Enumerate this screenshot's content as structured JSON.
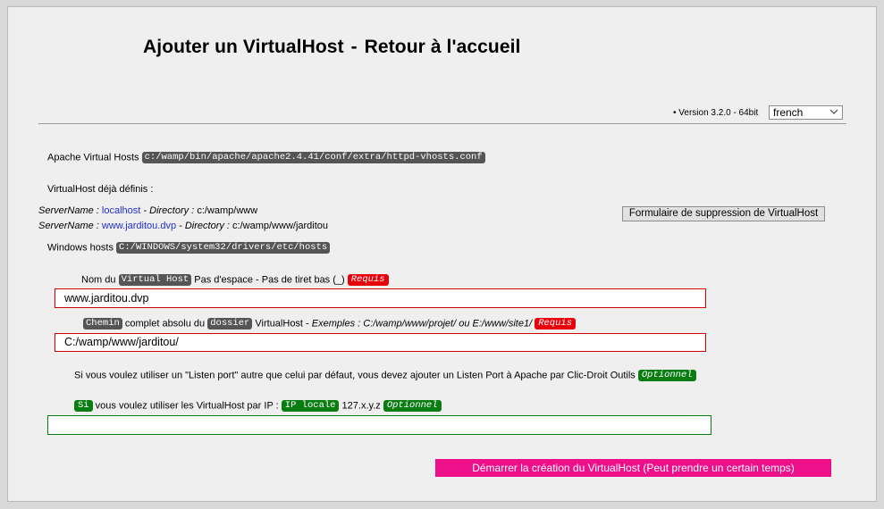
{
  "header": {
    "title_left": "Ajouter un VirtualHost",
    "title_sep": "-",
    "title_right": "Retour à l'accueil"
  },
  "version": {
    "bullet": "•",
    "text": "Version 3.2.0 - 64bit"
  },
  "language_select": {
    "value": "french"
  },
  "apache_vhosts": {
    "label": "Apache Virtual Hosts",
    "path": "c:/wamp/bin/apache/apache2.4.41/conf/extra/httpd-vhosts.conf"
  },
  "defined": {
    "heading": "VirtualHost déjà définis :",
    "entries": [
      {
        "sn_label": "ServerName :",
        "sn_value": "localhost",
        "dir_label": "- Directory :",
        "dir_value": "c:/wamp/www"
      },
      {
        "sn_label": "ServerName :",
        "sn_value": "www.jarditou.dvp",
        "dir_label": "- Directory :",
        "dir_value": "c:/wamp/www/jarditou"
      }
    ],
    "delete_button": "Formulaire de suppression de VirtualHost"
  },
  "windows_hosts": {
    "label": "Windows hosts",
    "path": "C:/WINDOWS/system32/drivers/etc/hosts"
  },
  "name_field": {
    "prefix": "Nom du",
    "badge": "Virtual Host",
    "hint": "Pas d'espace - Pas de tiret bas (_)",
    "required": "Requis",
    "value": "www.jarditou.dvp"
  },
  "path_field": {
    "badge1": "Chemin",
    "middle": "complet absolu du",
    "badge2": "dossier",
    "after": "VirtualHost -",
    "examples": "Exemples : C:/wamp/www/projet/ ou E:/www/site1/",
    "required": "Requis",
    "value": "C:/wamp/www/jarditou/"
  },
  "listen_port": {
    "text": "Si vous voulez utiliser un \"Listen port\" autre que celui par défaut, vous devez ajouter un Listen Port à Apache par Clic-Droit Outils",
    "optional": "Optionnel"
  },
  "ip_field": {
    "badge_si": "Si",
    "text": "vous voulez utiliser les VirtualHost par IP :",
    "badge_ip": "IP locale",
    "range": "127.x.y.z",
    "optional": "Optionnel",
    "value": ""
  },
  "submit": {
    "label": "Démarrer la création du VirtualHost (Peut prendre un certain temps)"
  }
}
